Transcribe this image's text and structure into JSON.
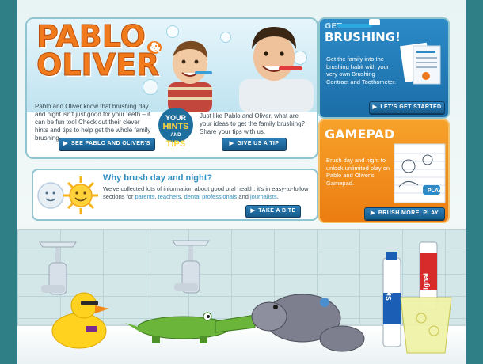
{
  "hero": {
    "logo_line1": "PABLO",
    "logo_amp": "&",
    "logo_line2": "OLIVER",
    "badge_top": "YOUR",
    "badge_mid": "HINTS",
    "badge_small": "AND",
    "badge_bottom": "TIPS",
    "intro_text": "Pablo and Oliver know that brushing day and night isn't just good for your teeth – it can be fun too! Check out their clever hints and tips to help get the whole family brushing.",
    "share_text": "Just like Pablo and Oliver, what are your ideas to get the family brushing? Share your tips with us.",
    "tips_button": "SEE PABLO AND OLIVER'S TIPS",
    "give_tip_button": "GIVE US A TIP"
  },
  "why": {
    "heading": "Why brush day and night?",
    "text_before": "We've collected lots of information about good oral health; it's in easy-to-follow sections for ",
    "link_parents": "parents",
    "sep1": ", ",
    "link_teachers": "teachers",
    "sep2": ", ",
    "link_dental": "dental professionals",
    "sep3": " and ",
    "link_journalists": "journalists",
    "text_after": ".",
    "button": "TAKE A BITE"
  },
  "brushing": {
    "title_small": "GET",
    "title_big": "BRUSHING!",
    "text": "Get the family into the brushing habit with your very own Brushing Contract and Toothometer.",
    "button": "LET'S GET STARTED"
  },
  "gamepad": {
    "title": "GAMEPAD",
    "text": "Brush day and night to unlock unlimited play on Pablo and Oliver's Gamepad.",
    "play_label": "PLAY",
    "button": "BRUSH MORE, PLAY MORE"
  },
  "toothpaste": {
    "brand": "Signal",
    "brand_small": "Signal"
  },
  "colors": {
    "accent_blue": "#1b6ea8",
    "accent_orange": "#ec7d11",
    "link": "#2f8fbf"
  }
}
